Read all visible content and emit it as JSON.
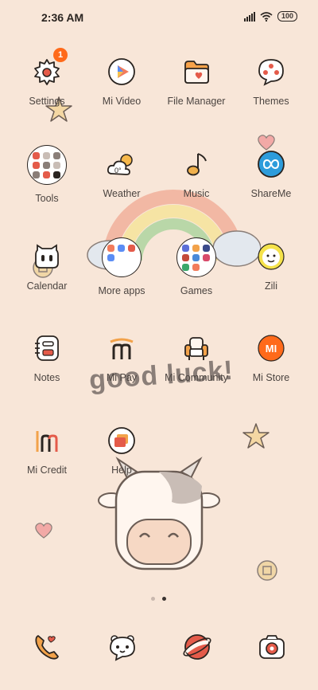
{
  "status_bar": {
    "time": "2:36 AM",
    "battery": "100"
  },
  "wallpaper": {
    "text": "good luck!"
  },
  "settings_badge": "1",
  "apps": [
    {
      "id": "settings",
      "label": "Settings"
    },
    {
      "id": "mi-video",
      "label": "Mi Video"
    },
    {
      "id": "file-manager",
      "label": "File Manager"
    },
    {
      "id": "themes",
      "label": "Themes"
    },
    {
      "id": "tools",
      "label": "Tools"
    },
    {
      "id": "weather",
      "label": "Weather"
    },
    {
      "id": "music",
      "label": "Music"
    },
    {
      "id": "shareme",
      "label": "ShareMe"
    },
    {
      "id": "calendar",
      "label": "Calendar"
    },
    {
      "id": "more-apps",
      "label": "More apps"
    },
    {
      "id": "games",
      "label": "Games"
    },
    {
      "id": "zili",
      "label": "Zili"
    },
    {
      "id": "notes",
      "label": "Notes"
    },
    {
      "id": "mi-pay",
      "label": "Mi Pay"
    },
    {
      "id": "mi-community",
      "label": "Mi Community"
    },
    {
      "id": "mi-store",
      "label": "Mi Store"
    },
    {
      "id": "mi-credit",
      "label": "Mi Credit"
    },
    {
      "id": "help",
      "label": "Help"
    }
  ],
  "page_indicator": {
    "pages": 2,
    "current": 2
  },
  "dock": [
    "phone",
    "messages",
    "browser",
    "camera"
  ]
}
